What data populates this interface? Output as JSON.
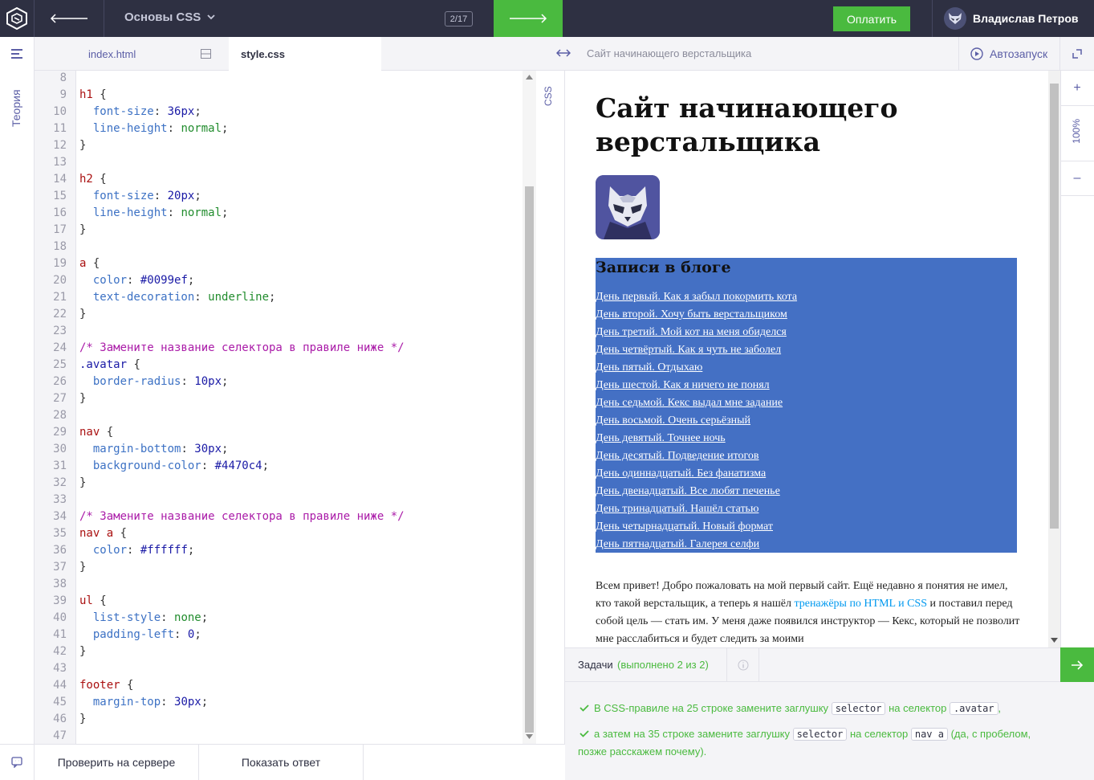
{
  "topbar": {
    "course": "Основы CSS",
    "step": "2/17",
    "pay_label": "Оплатить",
    "user_name": "Владислав Петров"
  },
  "sidebar": {
    "theory_label": "Теория"
  },
  "tabs": [
    {
      "label": "index.html"
    },
    {
      "label": "style.css",
      "active": true
    }
  ],
  "editor": {
    "lang_label": "CSS",
    "lines": [
      {
        "n": "8",
        "t": ""
      },
      {
        "n": "9",
        "t": "h1 {"
      },
      {
        "n": "10",
        "t": "  font-size: 36px;"
      },
      {
        "n": "11",
        "t": "  line-height: normal;"
      },
      {
        "n": "12",
        "t": "}"
      },
      {
        "n": "13",
        "t": ""
      },
      {
        "n": "14",
        "t": "h2 {"
      },
      {
        "n": "15",
        "t": "  font-size: 20px;"
      },
      {
        "n": "16",
        "t": "  line-height: normal;"
      },
      {
        "n": "17",
        "t": "}"
      },
      {
        "n": "18",
        "t": ""
      },
      {
        "n": "19",
        "t": "a {"
      },
      {
        "n": "20",
        "t": "  color: #0099ef;"
      },
      {
        "n": "21",
        "t": "  text-decoration: underline;"
      },
      {
        "n": "22",
        "t": "}"
      },
      {
        "n": "23",
        "t": ""
      },
      {
        "n": "24",
        "t": "/* Замените название селектора в правиле ниже */"
      },
      {
        "n": "25",
        "t": ".avatar {"
      },
      {
        "n": "26",
        "t": "  border-radius: 10px;"
      },
      {
        "n": "27",
        "t": "}"
      },
      {
        "n": "28",
        "t": ""
      },
      {
        "n": "29",
        "t": "nav {"
      },
      {
        "n": "30",
        "t": "  margin-bottom: 30px;"
      },
      {
        "n": "31",
        "t": "  background-color: #4470c4;"
      },
      {
        "n": "32",
        "t": "}"
      },
      {
        "n": "33",
        "t": ""
      },
      {
        "n": "34",
        "t": "/* Замените название селектора в правиле ниже */"
      },
      {
        "n": "35",
        "t": "nav a {"
      },
      {
        "n": "36",
        "t": "  color: #ffffff;"
      },
      {
        "n": "37",
        "t": "}"
      },
      {
        "n": "38",
        "t": ""
      },
      {
        "n": "39",
        "t": "ul {"
      },
      {
        "n": "40",
        "t": "  list-style: none;"
      },
      {
        "n": "41",
        "t": "  padding-left: 0;"
      },
      {
        "n": "42",
        "t": "}"
      },
      {
        "n": "43",
        "t": ""
      },
      {
        "n": "44",
        "t": "footer {"
      },
      {
        "n": "45",
        "t": "  margin-top: 30px;"
      },
      {
        "n": "46",
        "t": "}"
      },
      {
        "n": "47",
        "t": ""
      }
    ]
  },
  "preview": {
    "header_title": "Сайт начинающего верстальщика",
    "autorun_label": "Автозапуск",
    "zoom": "100%",
    "zoom_plus": "+",
    "zoom_minus": "–",
    "site_title": "Сайт начинающего верстальщика",
    "blog_heading": "Записи в блоге",
    "blog_links": [
      "День первый. Как я забыл покормить кота",
      "День второй. Хочу быть верстальщиком",
      "День третий. Мой кот на меня обиделся",
      "День четвёртый. Как я чуть не заболел",
      "День пятый. Отдыхаю",
      "День шестой. Как я ничего не понял",
      "День седьмой. Кекс выдал мне задание",
      "День восьмой. Очень серьёзный",
      "День девятый. Точнее ночь",
      "День десятый. Подведение итогов",
      "День одиннадцатый. Без фанатизма",
      "День двенадцатый. Все любят печенье",
      "День тринадцатый. Нашёл статью",
      "День четырнадцатый. Новый формат",
      "День пятнадцатый. Галерея селфи"
    ],
    "intro_before": "Всем привет! Добро пожаловать на мой первый сайт. Ещё недавно я понятия не имел, кто такой верстальщик, а теперь я нашёл ",
    "intro_link": "тренажёры по HTML и CSS",
    "intro_after": " и поставил перед собой цель — стать им. У меня даже появился инструктор — Кекс, который не позволит мне расслабиться и будет следить за моими",
    "link_color": "#0099ef",
    "nav_bg": "#4470c4"
  },
  "tasks": {
    "label": "Задачи",
    "done": "(выполнено 2 из 2)",
    "items": [
      {
        "parts": [
          "В CSS-правиле на 25 строке замените заглушку ",
          "selector",
          " на селектор ",
          ".avatar",
          ","
        ]
      },
      {
        "parts": [
          "а затем на 35 строке замените заглушку ",
          "selector",
          " на селектор ",
          "nav a",
          " (да, с пробелом, позже расскажем почему)."
        ]
      }
    ]
  },
  "bottom": {
    "check_label": "Проверить на сервере",
    "answer_label": "Показать ответ"
  },
  "colors": {
    "accent_green": "#4aba3f",
    "topbar": "#2e3042",
    "purple": "#5b5ea6"
  }
}
